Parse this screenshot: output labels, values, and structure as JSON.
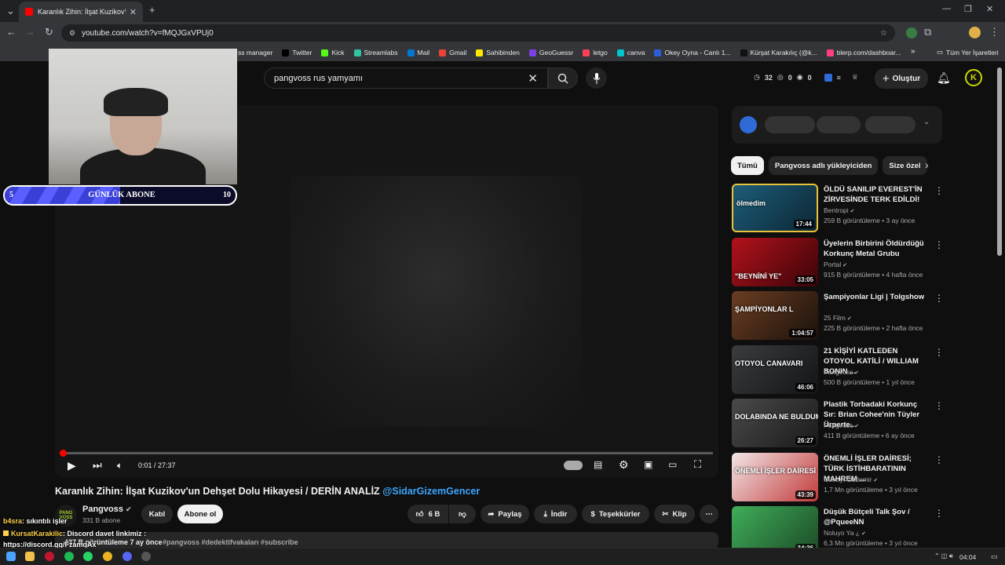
{
  "browser": {
    "tab_title": "Karanlık Zihin: İlşat Kuzikov'un D",
    "tab_close": "✕",
    "new_tab": "+",
    "url": "youtube.com/watch?v=fMQJGxVPUj0",
    "bookmarks": [
      {
        "label": "ss manager",
        "color": "#5f6368"
      },
      {
        "label": "Twitter",
        "color": "#000000"
      },
      {
        "label": "Kick",
        "color": "#53fc18"
      },
      {
        "label": "Streamlabs",
        "color": "#31c3a2"
      },
      {
        "label": "Mail",
        "color": "#0078d4"
      },
      {
        "label": "Gmail",
        "color": "#ea4335"
      },
      {
        "label": "Sahibinden",
        "color": "#ffe800"
      },
      {
        "label": "GeoGuessr",
        "color": "#7b3fe4"
      },
      {
        "label": "letgo",
        "color": "#ff3f55"
      },
      {
        "label": "canva",
        "color": "#00c4cc"
      },
      {
        "label": "Okey Oyna - Canlı 1...",
        "color": "#2b5fd9"
      },
      {
        "label": "Kürşat Karakılıç (@k...",
        "color": "#111111"
      },
      {
        "label": "blerp.com/dashboar...",
        "color": "#ff3d7f"
      }
    ],
    "bookmarks_more": "»",
    "all_bookmarks": "Tüm Yer İşaretleri"
  },
  "youtube": {
    "search_value": "pangvoss rus yamyamı",
    "header_stats": {
      "views": "32",
      "a": "0",
      "b": "0"
    },
    "create_label": "Oluştur",
    "avatar_letter": "K"
  },
  "overlay": {
    "sub_left": "5",
    "sub_label": "GÜNLÜK ABONE",
    "sub_right": "10",
    "sub_progress": 0.5
  },
  "player": {
    "time": "0:01 / 27:37",
    "progress": 0.001
  },
  "video": {
    "title": "Karanlık Zihin: İlşat Kuzikov'un Dehşet Dolu Hikayesi / DERİN ANALİZ",
    "title_mention": "@SidarGizemGencer",
    "channel_name": "Pangvoss",
    "channel_avatar": "PANG VOSS",
    "subscribers": "331 B abone",
    "join_label": "Katıl",
    "subscribe_label": "Abone ol",
    "likes": "6 B",
    "share_label": "Paylaş",
    "download_label": "İndir",
    "thanks_label": "Teşekkürler",
    "clip_label": "Klip",
    "more_label": "⋯",
    "description_meta": "437 B görüntüleme  7 ay önce",
    "hashtags": "#pangvoss #dedektifvakaları #subscribe"
  },
  "chat": [
    {
      "user": "b4sra",
      "user_color": "#ffd24a",
      "text": ": sıkıntılı işler"
    },
    {
      "user": "KursatKarakilic",
      "user_color": "#ffd24a",
      "text": ": Discord davet linkimiz :"
    },
    {
      "user": "",
      "user_color": "#ffffff",
      "text": "https://discord.gg/FzamqAx"
    }
  ],
  "sidebar": {
    "chips": [
      "Tümü",
      "Pangvoss adlı yükleyiciden",
      "Size özel"
    ],
    "videos": [
      {
        "title": "ÖLDÜ SANILIP EVEREST'İN ZİRVESİNDE TERK EDİLDİ!",
        "channel": "Bentropi",
        "meta": "259 B görüntüleme • 3 ay önce",
        "duration": "17:44",
        "overlay_text": "ölmedim",
        "thumb_a": "#1d5d7a",
        "thumb_b": "#0c2633"
      },
      {
        "title": "Üyelerin Birbirini Öldürdüğü Korkunç Metal Grubu",
        "channel": "Portal",
        "meta": "915 B görüntüleme • 4 hafta önce",
        "duration": "33:05",
        "overlay_text": "\"BEYNİNİ YE\"",
        "thumb_a": "#b3121c",
        "thumb_b": "#3a0408"
      },
      {
        "title": "Şampiyonlar Ligi | Tolgshow",
        "channel": "25 Film",
        "meta": "225 B görüntüleme • 2 hafta önce",
        "duration": "1:04:57",
        "overlay_text": "ŞAMPİYONLAR L",
        "thumb_a": "#6b3d22",
        "thumb_b": "#1b120c"
      },
      {
        "title": "21 KİŞİYİ KATLEDEN OTOYOL KATİLİ / WILLIAM BONIN ...",
        "channel": "Pangvoss",
        "meta": "500 B görüntüleme • 1 yıl önce",
        "duration": "46:06",
        "overlay_text": "OTOYOL CANAVARI",
        "thumb_a": "#3a3d40",
        "thumb_b": "#121416"
      },
      {
        "title": "Plastik Torbadaki Korkunç Sır: Brian Cohee'nin Tüyler Ürperte...",
        "channel": "Pangvoss",
        "meta": "411 B görüntüleme • 6 ay önce",
        "duration": "26:27",
        "overlay_text": "DOLABINDA NE BULDUM ?!",
        "thumb_a": "#4a4a4a",
        "thumb_b": "#1a1a1a"
      },
      {
        "title": "ÖNEMLİ İŞLER DAİRESİ; TÜRK İSTİHBARATININ MAHREM ...",
        "channel": "Cüneyt Özdemir",
        "meta": "1,7 Mn görüntüleme • 3 yıl önce",
        "duration": "43:39",
        "overlay_text": "ÖNEMLİ İŞLER DAİRESİ",
        "thumb_a": "#f2e6e6",
        "thumb_b": "#c23a3a"
      },
      {
        "title": "Düşük Bütçeli Talk Şov / @PqueeNN",
        "channel": "Noluyo Ya ¿",
        "meta": "6,3 Mn görüntüleme • 3 yıl önce",
        "duration": "34:36",
        "overlay_text": "",
        "thumb_a": "#3fae5a",
        "thumb_b": "#1c4a26"
      }
    ]
  },
  "taskbar": {
    "time": "04:04"
  },
  "colors": {
    "accent": "#ff0000",
    "mention": "#3ea6ff",
    "sub_fill": "#4b50f0"
  }
}
